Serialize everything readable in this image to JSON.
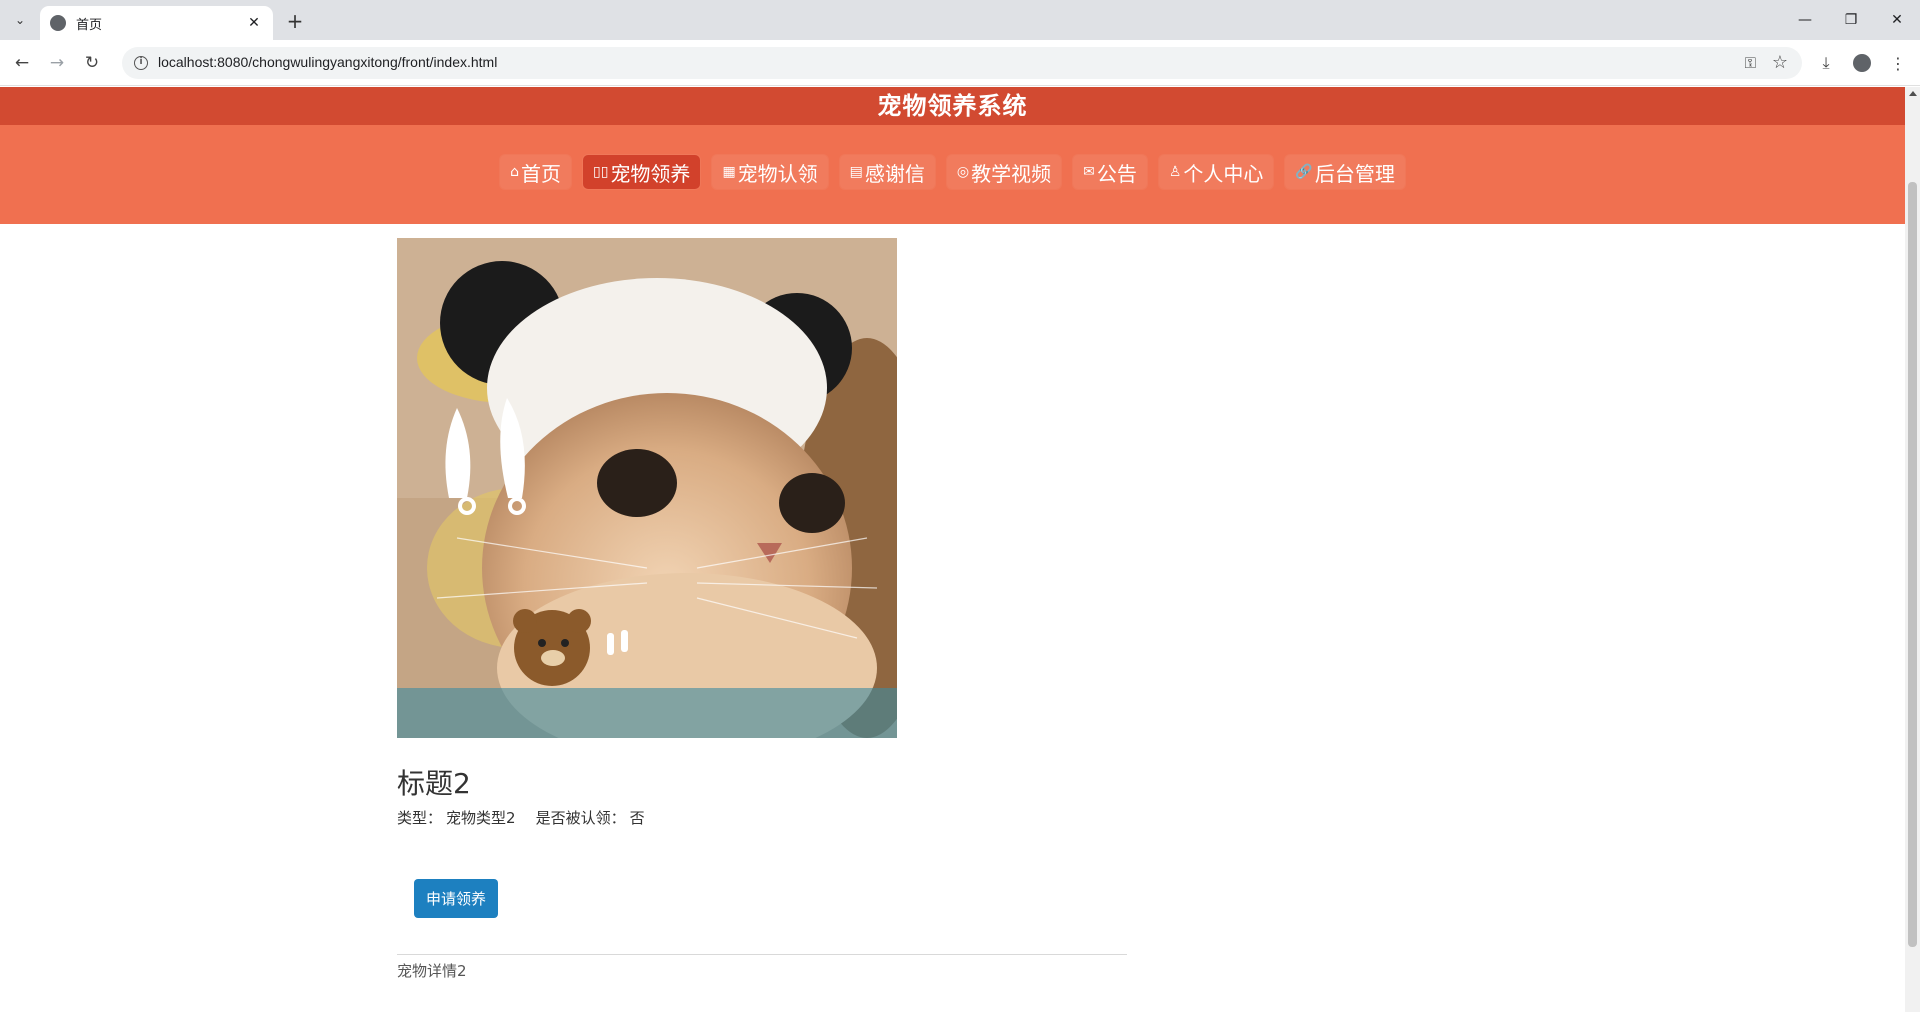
{
  "browser": {
    "tab_title": "首页",
    "url": "localhost:8080/chongwulingyangxitong/front/index.html"
  },
  "site": {
    "title": "宠物领养系统",
    "nav": [
      {
        "label": "首页",
        "icon": "home-icon",
        "active": false
      },
      {
        "label": "宠物领养",
        "icon": "book-icon",
        "active": true
      },
      {
        "label": "宠物认领",
        "icon": "grid-icon",
        "active": false
      },
      {
        "label": "感谢信",
        "icon": "document-icon",
        "active": false
      },
      {
        "label": "教学视频",
        "icon": "video-icon",
        "active": false
      },
      {
        "label": "公告",
        "icon": "mail-icon",
        "active": false
      },
      {
        "label": "个人中心",
        "icon": "user-icon",
        "active": false
      },
      {
        "label": "后台管理",
        "icon": "link-icon",
        "active": false
      }
    ]
  },
  "pet": {
    "title": "标题2",
    "type_label": "类型：",
    "type_value": "宠物类型2",
    "adopted_label": "是否被认领：",
    "adopted_value": "否",
    "apply_button": "申请领养",
    "detail": "宠物详情2"
  },
  "colors": {
    "header": "#d24a31",
    "nav_band": "#f07050",
    "nav_active": "#d2412b",
    "primary_button": "#1d80c0"
  }
}
